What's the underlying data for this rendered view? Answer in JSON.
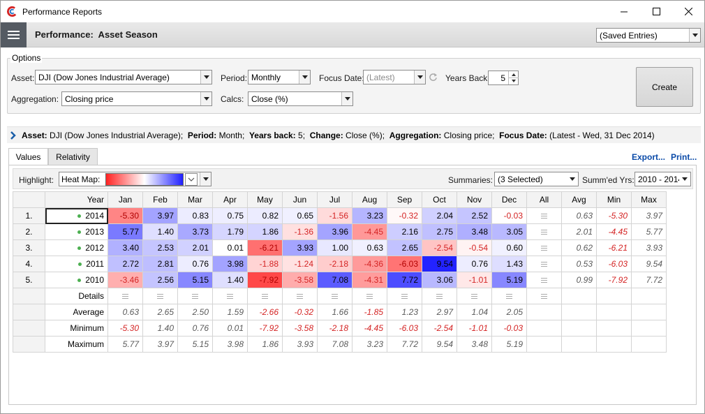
{
  "window": {
    "title": "Performance Reports"
  },
  "header": {
    "title": "Performance:  Asset Season",
    "saved_entries": "(Saved Entries)"
  },
  "options": {
    "legend": "Options",
    "asset_label": "Asset:",
    "asset_value": "DJI (Dow Jones Industrial Average)",
    "period_label": "Period:",
    "period_value": "Monthly",
    "focus_label": "Focus Date:",
    "focus_value": "(Latest)",
    "years_back_label": "Years Back:",
    "years_back_value": "5",
    "aggregation_label": "Aggregation:",
    "aggregation_value": "Closing price",
    "calcs_label": "Calcs:",
    "calcs_value": "Close (%)",
    "create_label": "Create"
  },
  "summary": {
    "asset_key": "Asset:",
    "asset_val": "DJI (Dow Jones Industrial Average);",
    "period_key": "Period:",
    "period_val": "Month;",
    "years_key": "Years back:",
    "years_val": "5;",
    "change_key": "Change:",
    "change_val": "Close (%);",
    "agg_key": "Aggregation:",
    "agg_val": "Closing price;",
    "focus_key": "Focus Date:",
    "focus_val": "(Latest - Wed, 31 Dec 2014)"
  },
  "tabs": [
    {
      "label": "Values"
    },
    {
      "label": "Relativity"
    }
  ],
  "links": {
    "export": "Export...",
    "print": "Print..."
  },
  "toolbar": {
    "highlight_label": "Highlight:",
    "heatmap_label": "Heat Map:",
    "summaries_label": "Summaries:",
    "summaries_value": "(3 Selected)",
    "summed_label": "Summ'ed Yrs:",
    "summed_value": "2010 - 2014"
  },
  "grid": {
    "year_header": "Year",
    "months": [
      "Jan",
      "Feb",
      "Mar",
      "Apr",
      "May",
      "Jun",
      "Jul",
      "Aug",
      "Sep",
      "Oct",
      "Nov",
      "Dec"
    ],
    "all_header": "All",
    "avg_header": "Avg",
    "min_header": "Min",
    "max_header": "Max",
    "rows": [
      {
        "num": "1.",
        "year": "2014",
        "values": [
          "-5.30",
          "3.97",
          "0.83",
          "0.75",
          "0.82",
          "0.65",
          "-1.56",
          "3.23",
          "-0.32",
          "2.04",
          "2.52",
          "-0.03"
        ],
        "avg": "0.63",
        "min": "-5.30",
        "max": "3.97"
      },
      {
        "num": "2.",
        "year": "2013",
        "values": [
          "5.77",
          "1.40",
          "3.73",
          "1.79",
          "1.86",
          "-1.36",
          "3.96",
          "-4.45",
          "2.16",
          "2.75",
          "3.48",
          "3.05"
        ],
        "avg": "2.01",
        "min": "-4.45",
        "max": "5.77"
      },
      {
        "num": "3.",
        "year": "2012",
        "values": [
          "3.40",
          "2.53",
          "2.01",
          "0.01",
          "-6.21",
          "3.93",
          "1.00",
          "0.63",
          "2.65",
          "-2.54",
          "-0.54",
          "0.60"
        ],
        "avg": "0.62",
        "min": "-6.21",
        "max": "3.93"
      },
      {
        "num": "4.",
        "year": "2011",
        "values": [
          "2.72",
          "2.81",
          "0.76",
          "3.98",
          "-1.88",
          "-1.24",
          "-2.18",
          "-4.36",
          "-6.03",
          "9.54",
          "0.76",
          "1.43"
        ],
        "avg": "0.53",
        "min": "-6.03",
        "max": "9.54"
      },
      {
        "num": "5.",
        "year": "2010",
        "values": [
          "-3.46",
          "2.56",
          "5.15",
          "1.40",
          "-7.92",
          "-3.58",
          "7.08",
          "-4.31",
          "7.72",
          "3.06",
          "-1.01",
          "5.19"
        ],
        "avg": "0.99",
        "min": "-7.92",
        "max": "7.72"
      }
    ],
    "details_label": "Details",
    "summary_rows": [
      {
        "label": "Average",
        "values": [
          "0.63",
          "2.65",
          "2.50",
          "1.59",
          "-2.66",
          "-0.32",
          "1.66",
          "-1.85",
          "1.23",
          "2.97",
          "1.04",
          "2.05"
        ]
      },
      {
        "label": "Minimum",
        "values": [
          "-5.30",
          "1.40",
          "0.76",
          "0.01",
          "-7.92",
          "-3.58",
          "-2.18",
          "-4.45",
          "-6.03",
          "-2.54",
          "-1.01",
          "-0.03"
        ]
      },
      {
        "label": "Maximum",
        "values": [
          "5.77",
          "3.97",
          "5.15",
          "3.98",
          "1.86",
          "3.93",
          "7.08",
          "3.23",
          "7.72",
          "9.54",
          "3.48",
          "5.19"
        ]
      }
    ]
  },
  "colors": {
    "heat_negative": "#ff2222",
    "heat_positive": "#1f1fff",
    "link": "#0a4aa8",
    "header_menu": "#555b63"
  }
}
